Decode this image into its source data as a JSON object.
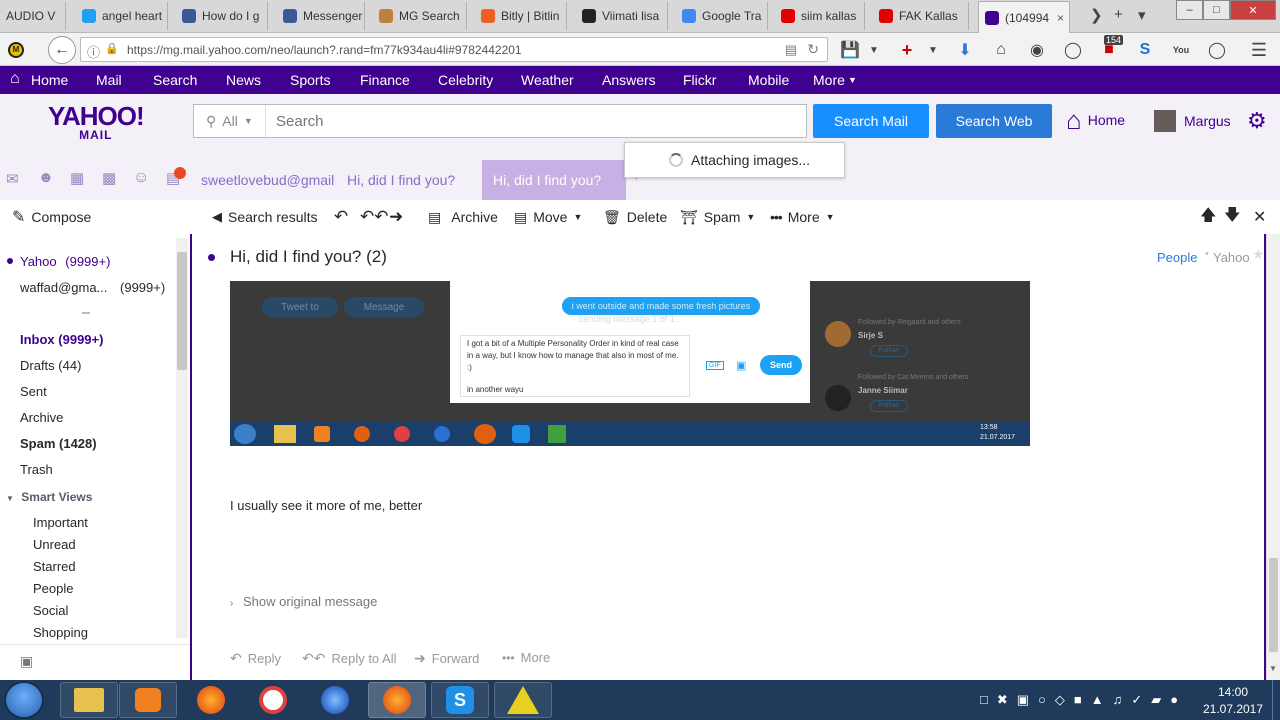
{
  "browser": {
    "tabs": [
      {
        "label": "AUDIO V",
        "color": "#888888"
      },
      {
        "label": "angel heart",
        "color": "#1da1f2"
      },
      {
        "label": "How do I g",
        "color": "#3b5998"
      },
      {
        "label": "Messenger",
        "color": "#3b5998"
      },
      {
        "label": "MG Search",
        "color": "#c08040"
      },
      {
        "label": "Bitly | Bitlin",
        "color": "#ee6123"
      },
      {
        "label": "Viimati lisa",
        "color": "#222222"
      },
      {
        "label": "Google Tra",
        "color": "#4285f4"
      },
      {
        "label": "siim kallas",
        "color": "#e00000"
      },
      {
        "label": "FAK Kallas",
        "color": "#e00000"
      },
      {
        "label": "(104994",
        "color": "#400090"
      }
    ],
    "url": "https://mg.mail.yahoo.com/neo/launch?.rand=fm77k934au4li#9782442201",
    "badge_count": "154"
  },
  "yahoo_nav": {
    "items": [
      "Home",
      "Mail",
      "Search",
      "News",
      "Sports",
      "Finance",
      "Celebrity",
      "Weather",
      "Answers",
      "Flickr",
      "Mobile",
      "More"
    ]
  },
  "header": {
    "logo_top": "YAHOO!",
    "logo_bottom": "MAIL",
    "search_scope": "All",
    "search_placeholder": "Search",
    "search_mail_label": "Search Mail",
    "search_web_label": "Search Web",
    "home_label": "Home",
    "user_name": "Margus"
  },
  "app_tabs": [
    "sweetlovebud@gmail",
    "Hi, did I find you?",
    "Hi, did I find you?"
  ],
  "notification": "Attaching images...",
  "toolbar": {
    "compose": "Compose",
    "search_results": "Search results",
    "archive": "Archive",
    "move": "Move",
    "delete": "Delete",
    "spam": "Spam",
    "more": "More"
  },
  "sidebar": {
    "accounts": [
      {
        "name": "Yahoo",
        "count": "(9999+)"
      },
      {
        "name": "waffad@gma...",
        "count": "(9999+)"
      }
    ],
    "folders": [
      {
        "label": "Inbox (9999+)",
        "bold": true
      },
      {
        "label": "Drafts (44)",
        "bold": false
      },
      {
        "label": "Sent",
        "bold": false
      },
      {
        "label": "Archive",
        "bold": false
      },
      {
        "label": "Spam (1428)",
        "bold": true
      },
      {
        "label": "Trash",
        "bold": false
      }
    ],
    "smart_views_label": "Smart Views",
    "smart_views": [
      "Important",
      "Unread",
      "Starred",
      "People",
      "Social",
      "Shopping"
    ]
  },
  "message": {
    "subject": "Hi, did I find you? (2)",
    "people_label": "People",
    "yahoo_label": "Yahoo",
    "body": "I usually see it more of me, better",
    "show_original": "Show original message",
    "actions": [
      "Reply",
      "Reply to All",
      "Forward",
      "More"
    ]
  },
  "embedded_screenshot": {
    "left_buttons": [
      "Tweet to",
      "Message"
    ],
    "chat_bubble": "i went outside and made some fresh pictures",
    "sending": "Sending message 1 of 1...",
    "compose_text": "I got a bit of a Multiple Personality Order in kind of real case in a way, but I know how to manage that also in most of me. :)",
    "compose_text2": "in another wayu",
    "send_label": "Send",
    "gif_label": "GIF",
    "follows": [
      {
        "name": "Sirje S",
        "note": "Followed by Reigaard and others",
        "btn": "Follow"
      },
      {
        "name": "Janne Siimar",
        "note": "Followed by Cat Meemo and others",
        "btn": "Follow"
      }
    ],
    "time": "13:58",
    "date": "21.07.2017"
  },
  "taskbar": {
    "time": "14:00",
    "date": "21.07.2017"
  }
}
